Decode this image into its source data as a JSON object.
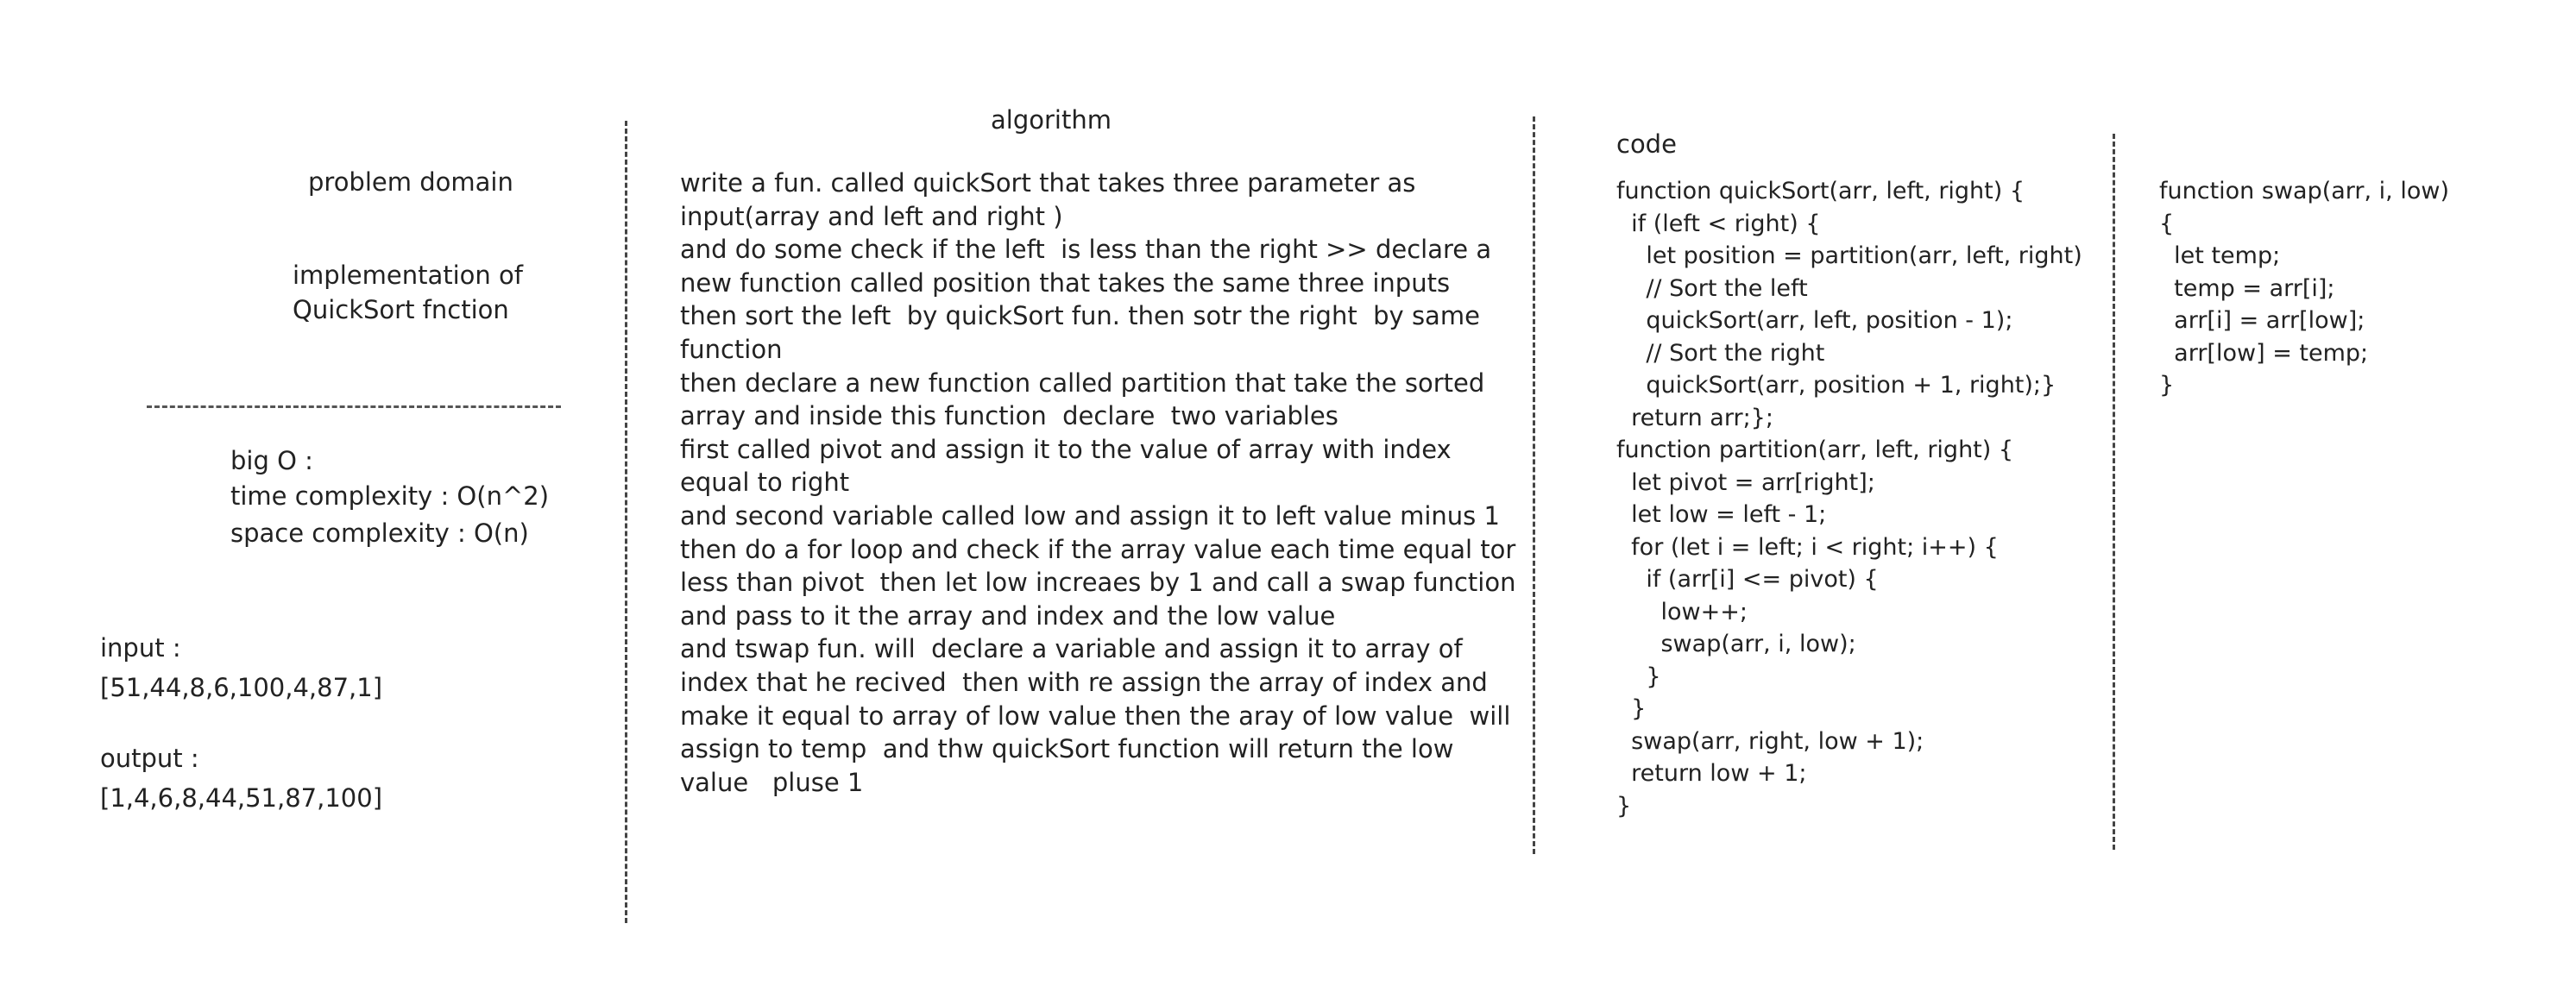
{
  "left": {
    "problem_domain": "problem domain",
    "impl_line1": "implementation of",
    "impl_line2": "QuickSort fnction",
    "big_o": "big O :",
    "time_complexity": "time complexity : O(n^2)",
    "space_complexity": "space complexity : O(n)",
    "input_label": "input :",
    "input_value": "[51,44,8,6,100,4,87,1]",
    "output_label": "output :",
    "output_value": "[1,4,6,8,44,51,87,100]"
  },
  "algorithm": {
    "title": "algorithm",
    "lines": [
      "write a fun. called quickSort that takes three parameter as",
      "input(array and left and right )",
      "and do some check if the left  is less than the right >> declare a",
      "new function called position that takes the same three inputs",
      "then sort the left  by quickSort fun. then sotr the right  by same",
      "function",
      "then declare a new function called partition that take the sorted",
      "array and inside this function  declare  two variables",
      "first called pivot and assign it to the value of array with index",
      "equal to right",
      "and second variable called low and assign it to left value minus 1",
      "then do a for loop and check if the array value each time equal tor",
      "less than pivot  then let low increaes by 1 and call a swap function",
      "and pass to it the array and index and the low value",
      "and tswap fun. will  declare a variable and assign it to array of",
      "index that he recived  then with re assign the array of index and",
      "make it equal to array of low value then the aray of low value  will",
      "assign to temp  and thw quickSort function will return the low",
      "value   pluse 1"
    ]
  },
  "code": {
    "title": "code",
    "lines": [
      "function quickSort(arr, left, right) {",
      "  if (left < right) {",
      "    let position = partition(arr, left, right)",
      "    // Sort the left",
      "    quickSort(arr, left, position - 1);",
      "    // Sort the right",
      "    quickSort(arr, position + 1, right);}",
      "  return arr;};",
      "function partition(arr, left, right) {",
      "  let pivot = arr[right];",
      "  let low = left - 1;",
      "  for (let i = left; i < right; i++) {",
      "    if (arr[i] <= pivot) {",
      "      low++;",
      "      swap(arr, i, low);",
      "    }",
      "  }",
      "  swap(arr, right, low + 1);",
      "  return low + 1;",
      "}"
    ]
  },
  "swap": {
    "lines": [
      "function swap(arr, i, low)",
      "{",
      "  let temp;",
      "  temp = arr[i];",
      "  arr[i] = arr[low];",
      "  arr[low] = temp;",
      "}"
    ]
  }
}
